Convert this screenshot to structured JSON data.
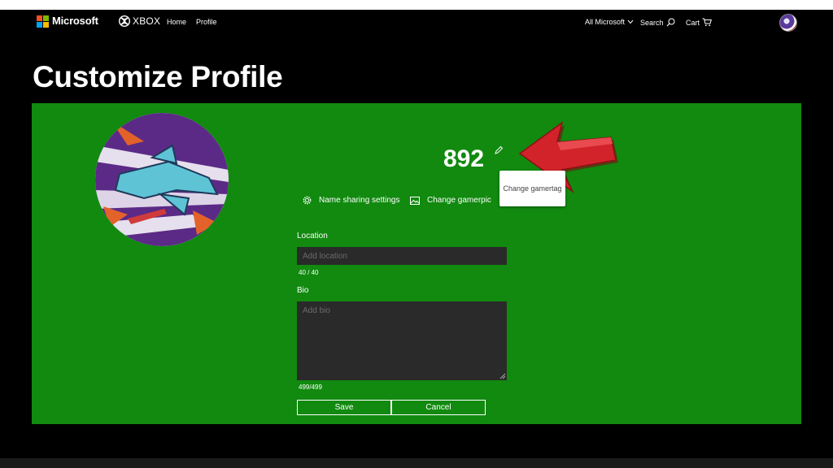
{
  "nav": {
    "brand": "Microsoft",
    "xbox": "XBOX",
    "links": [
      "Home",
      "Profile"
    ],
    "all_microsoft": "All Microsoft",
    "search": "Search",
    "cart": "Cart"
  },
  "page": {
    "title": "Customize Profile"
  },
  "profile": {
    "gamertag": "892",
    "tooltip": "Change gamertag"
  },
  "actions": {
    "name_sharing": "Name sharing settings",
    "change_gamerpic": "Change gamerpic"
  },
  "location": {
    "label": "Location",
    "placeholder": "Add location",
    "counter": "40 / 40"
  },
  "bio": {
    "label": "Bio",
    "placeholder": "Add bio",
    "counter": "499/499"
  },
  "buttons": {
    "save": "Save",
    "cancel": "Cancel"
  },
  "colors": {
    "panel": "#118a0f",
    "background": "#000000",
    "input": "#2a2a2a",
    "arrow": "#d2232a",
    "ms_red": "#f25022",
    "ms_green": "#7fba00",
    "ms_blue": "#00a4ef",
    "ms_yellow": "#ffb900"
  },
  "icons": [
    "microsoft-logo-icon",
    "xbox-logo-icon",
    "chevron-down-icon",
    "search-icon",
    "cart-icon",
    "pencil-icon",
    "gear-icon",
    "image-icon",
    "red-arrow-icon"
  ]
}
